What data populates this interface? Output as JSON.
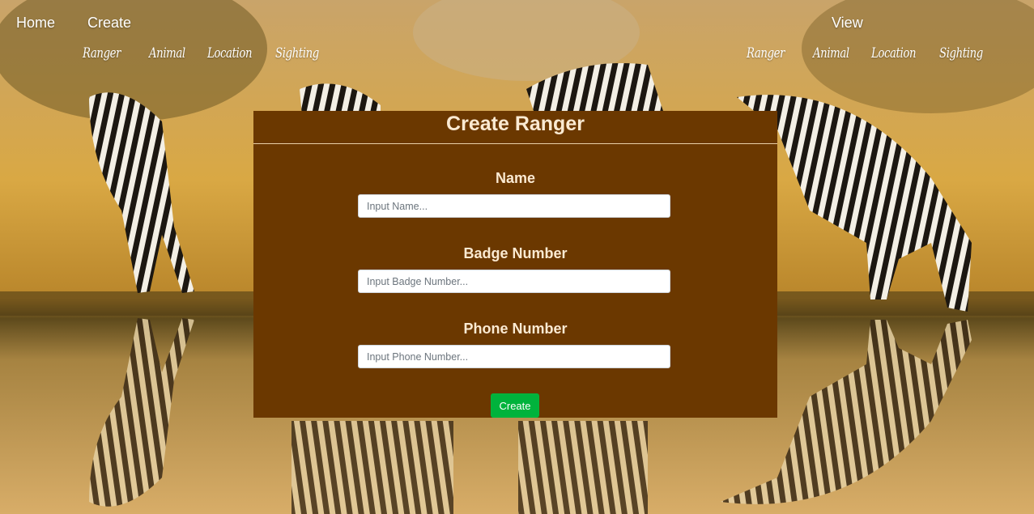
{
  "nav": {
    "home": "Home",
    "create": "Create",
    "view": "View",
    "create_items": [
      "Ranger",
      "Animal",
      "Location",
      "Sighting"
    ],
    "view_items": [
      "Ranger",
      "Animal",
      "Location",
      "Sighting"
    ]
  },
  "form": {
    "title": "Create Ranger",
    "fields": [
      {
        "label": "Name",
        "placeholder": "Input Name..."
      },
      {
        "label": "Badge Number",
        "placeholder": "Input Badge Number..."
      },
      {
        "label": "Phone Number",
        "placeholder": "Input Phone Number..."
      }
    ],
    "submit_label": "Create"
  },
  "colors": {
    "panel_bg": "#6b3800",
    "panel_text": "#fbead2",
    "button_bg": "#00b33c"
  },
  "background": {
    "icon": "zebras-at-waterhole-photo"
  }
}
